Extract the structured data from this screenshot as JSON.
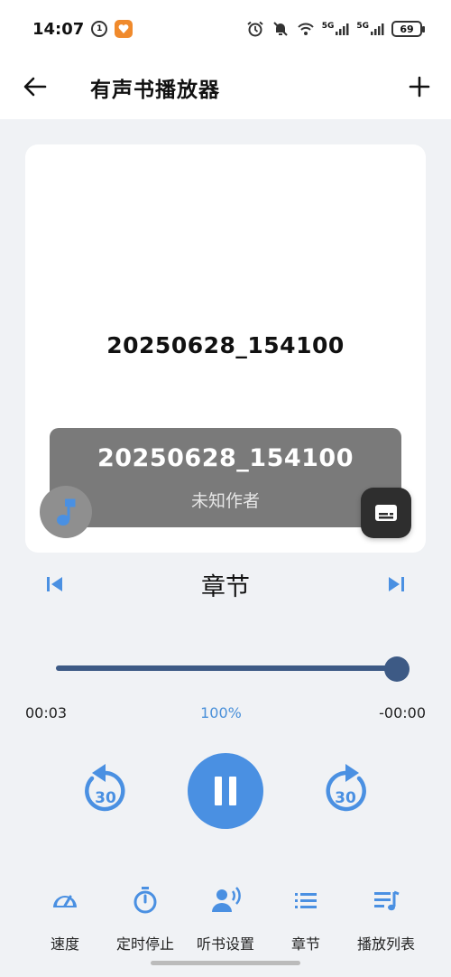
{
  "status_bar": {
    "time": "14:07",
    "mini_badge": "1",
    "network_5g_1": "5G",
    "network_5g_2": "5G",
    "battery": "69"
  },
  "app_bar": {
    "title": "有声书播放器",
    "back_icon": "arrow-left-icon",
    "add_icon": "plus-icon"
  },
  "cover": {
    "title": "20250628_154100"
  },
  "overlay": {
    "title": "20250628_154100",
    "author": "未知作者"
  },
  "chapter": {
    "label": "章节"
  },
  "progress": {
    "elapsed": "00:03",
    "speed": "100%",
    "remaining": "-00:00",
    "fraction": 1.0
  },
  "controls": {
    "rewind_seconds": "30",
    "forward_seconds": "30"
  },
  "bottom_bar": [
    {
      "label": "速度",
      "icon": "speedometer-icon"
    },
    {
      "label": "定时停止",
      "icon": "timer-icon"
    },
    {
      "label": "听书设置",
      "icon": "voice-settings-icon"
    },
    {
      "label": "章节",
      "icon": "list-icon"
    },
    {
      "label": "播放列表",
      "icon": "playlist-icon"
    }
  ],
  "colors": {
    "accent": "#4a90e2",
    "slider": "#3d5a85",
    "background": "#f0f2f5"
  }
}
